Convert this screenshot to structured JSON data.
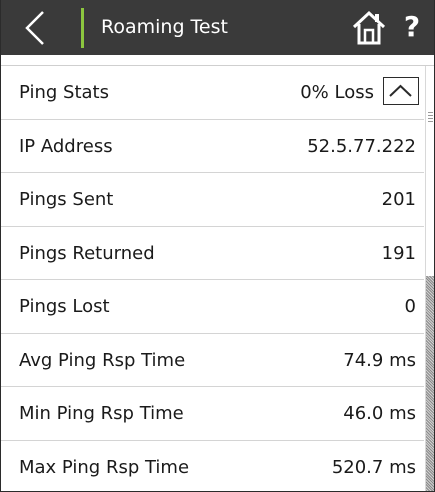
{
  "titlebar": {
    "title": "Roaming Test",
    "back_icon": "chevron-left-icon",
    "home_icon": "home-icon",
    "help_label": "?",
    "accent_color": "#8cc63f",
    "background_color": "#3a3a3a"
  },
  "section": {
    "label": "Ping Stats",
    "summary": "0% Loss",
    "collapse_icon": "chevron-up-icon"
  },
  "rows": [
    {
      "label": "IP Address",
      "value": "52.5.77.222"
    },
    {
      "label": "Pings Sent",
      "value": "201"
    },
    {
      "label": "Pings Returned",
      "value": "191"
    },
    {
      "label": "Pings Lost",
      "value": "0"
    },
    {
      "label": "Avg Ping Rsp Time",
      "value": "74.9 ms"
    },
    {
      "label": "Min Ping Rsp Time",
      "value": "46.0 ms"
    },
    {
      "label": "Max Ping Rsp Time",
      "value": "520.7 ms"
    }
  ]
}
